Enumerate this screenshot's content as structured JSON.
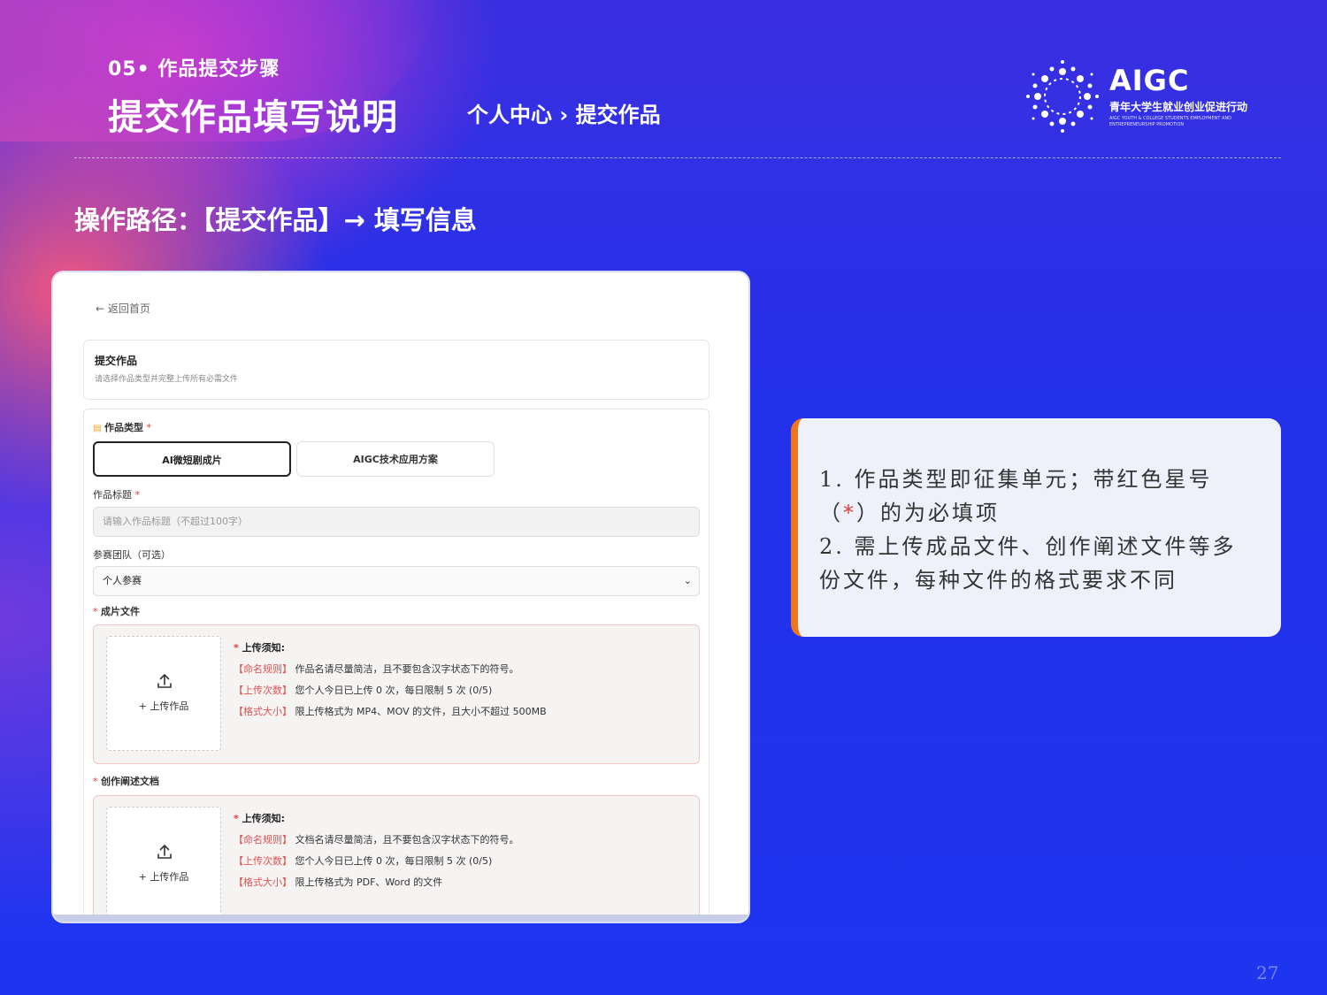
{
  "header": {
    "section_label": "05• 作品提交步骤",
    "page_title": "提交作品填写说明",
    "breadcrumb": "个人中心 › 提交作品"
  },
  "logo": {
    "title": "AIGC",
    "subtitle": "青年大学生就业创业促进行动",
    "tiny": "AIGC YOUTH & COLLEGE STUDENTS EMPLOYMENT AND ENTREPRENEURSHIP PROMOTION"
  },
  "operation_path": "操作路径：【提交作品】→ 填写信息",
  "screenshot": {
    "back_link": "← 返回首页",
    "submit_title": "提交作品",
    "submit_subtitle": "请选择作品类型并完整上传所有必需文件",
    "type_label": "作品类型",
    "type_options": [
      "AI微短剧成片",
      "AIGC技术应用方案"
    ],
    "title_label": "作品标题",
    "title_placeholder": "请输入作品标题（不超过100字）",
    "team_label": "参赛团队（可选）",
    "team_value": "个人参赛",
    "film_label": "成片文件",
    "doc_label": "创作阐述文档",
    "upload_button": "+ 上传作品",
    "notice_heading": "上传须知:",
    "film_notes": [
      {
        "tag": "【命名规则】",
        "text": "作品名请尽量简洁，且不要包含汉字状态下的符号。"
      },
      {
        "tag": "【上传次数】",
        "text": "您个人今日已上传 0 次，每日限制 5 次 (0/5)"
      },
      {
        "tag": "【格式大小】",
        "text": "限上传格式为 MP4、MOV 的文件，且大小不超过 500MB"
      }
    ],
    "doc_notes": [
      {
        "tag": "【命名规则】",
        "text": "文档名请尽量简洁，且不要包含汉字状态下的符号。"
      },
      {
        "tag": "【上传次数】",
        "text": "您个人今日已上传 0 次，每日限制 5 次 (0/5)"
      },
      {
        "tag": "【格式大小】",
        "text": "限上传格式为 PDF、Word 的文件"
      }
    ]
  },
  "info": {
    "line1a": "1. 作品类型即征集单元；带红色星号（",
    "star": "*",
    "line1b": "）的为必填项",
    "line2": "2. 需上传成品文件、创作阐述文件等多份文件，每种文件的格式要求不同"
  },
  "page_number": "27",
  "colors": {
    "accent_orange": "#f0761e",
    "required_red": "#e53a3a",
    "bg_blue": "#2a34e6"
  }
}
